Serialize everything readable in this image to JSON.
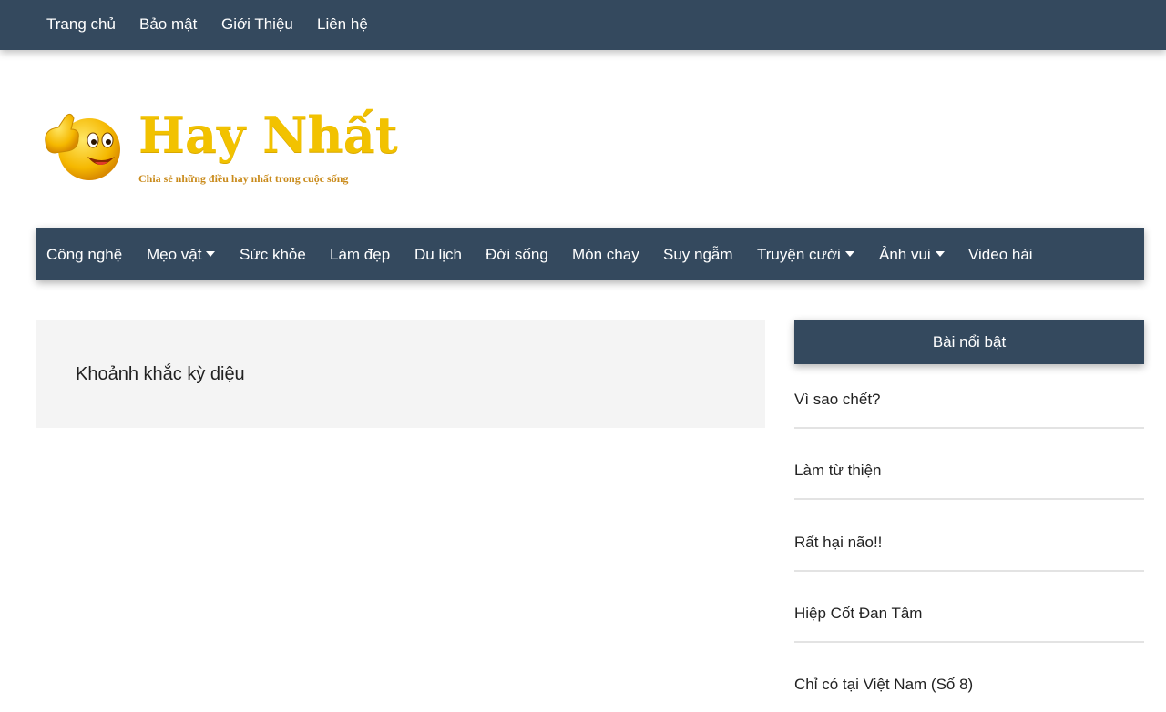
{
  "topbar": {
    "links": [
      "Trang chủ",
      "Bảo mật",
      "Giới Thiệu",
      "Liên hệ"
    ]
  },
  "logo": {
    "title": "Hay Nhất",
    "tagline": "Chia sẻ những điều hay nhất trong cuộc sống"
  },
  "nav": {
    "items": [
      {
        "label": "Công nghệ"
      },
      {
        "label": "Mẹo vặt",
        "dropdown": true
      },
      {
        "label": "Sức khỏe"
      },
      {
        "label": "Làm đẹp"
      },
      {
        "label": "Du lịch"
      },
      {
        "label": "Đời sống"
      },
      {
        "label": "Món chay"
      },
      {
        "label": "Suy ngẫm"
      },
      {
        "label": "Truyện cười",
        "dropdown": true
      },
      {
        "label": "Ảnh vui",
        "dropdown": true
      },
      {
        "label": "Video hài"
      }
    ]
  },
  "article": {
    "title": "Khoảnh khắc kỳ diệu"
  },
  "sidebar": {
    "header": "Bài nổi bật",
    "items": [
      "Vì sao chết?",
      "Làm từ thiện",
      "Rất hại não!!",
      "Hiệp Cốt Đan Tâm",
      "Chỉ có tại Việt Nam (Số 8)"
    ]
  },
  "colors": {
    "nav_bg": "#34495e",
    "logo_text": "#f2c200",
    "card_bg": "#f4f4f4"
  },
  "icons": {
    "logo_emoji": "thumbs-up-smiley-icon",
    "dropdown": "caret-down-icon"
  }
}
